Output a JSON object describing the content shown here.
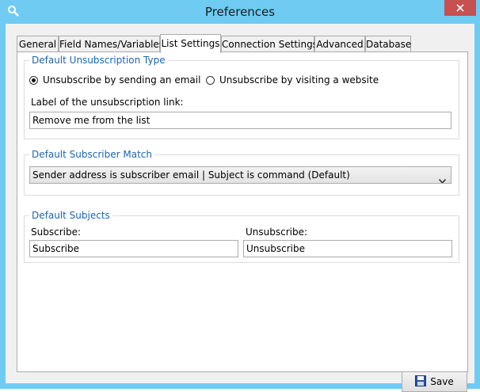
{
  "window": {
    "title": "Preferences"
  },
  "tabs": [
    {
      "label": "General"
    },
    {
      "label": "Field Names/Variables"
    },
    {
      "label": "List Settings"
    },
    {
      "label": "Connection Settings"
    },
    {
      "label": "Advanced"
    },
    {
      "label": "Database"
    }
  ],
  "active_tab": "List Settings",
  "unsubscription": {
    "legend": "Default Unsubscription Type",
    "option_email": "Unsubscribe by sending an email",
    "option_website": "Unsubscribe by visiting a website",
    "selected": "email",
    "link_label": "Label of the unsubscription link:",
    "link_value": "Remove me from the list"
  },
  "subscriber_match": {
    "legend": "Default Subscriber Match",
    "selected": "Sender address is subscriber email | Subject is command (Default)"
  },
  "subjects": {
    "legend": "Default Subjects",
    "subscribe_label": "Subscribe:",
    "subscribe_value": "Subscribe",
    "unsubscribe_label": "Unsubscribe:",
    "unsubscribe_value": "Unsubscribe"
  },
  "footer": {
    "save_label": "Save"
  },
  "colors": {
    "frame": "#6fcbf2",
    "close": "#c75050",
    "legend": "#1b66b1"
  }
}
